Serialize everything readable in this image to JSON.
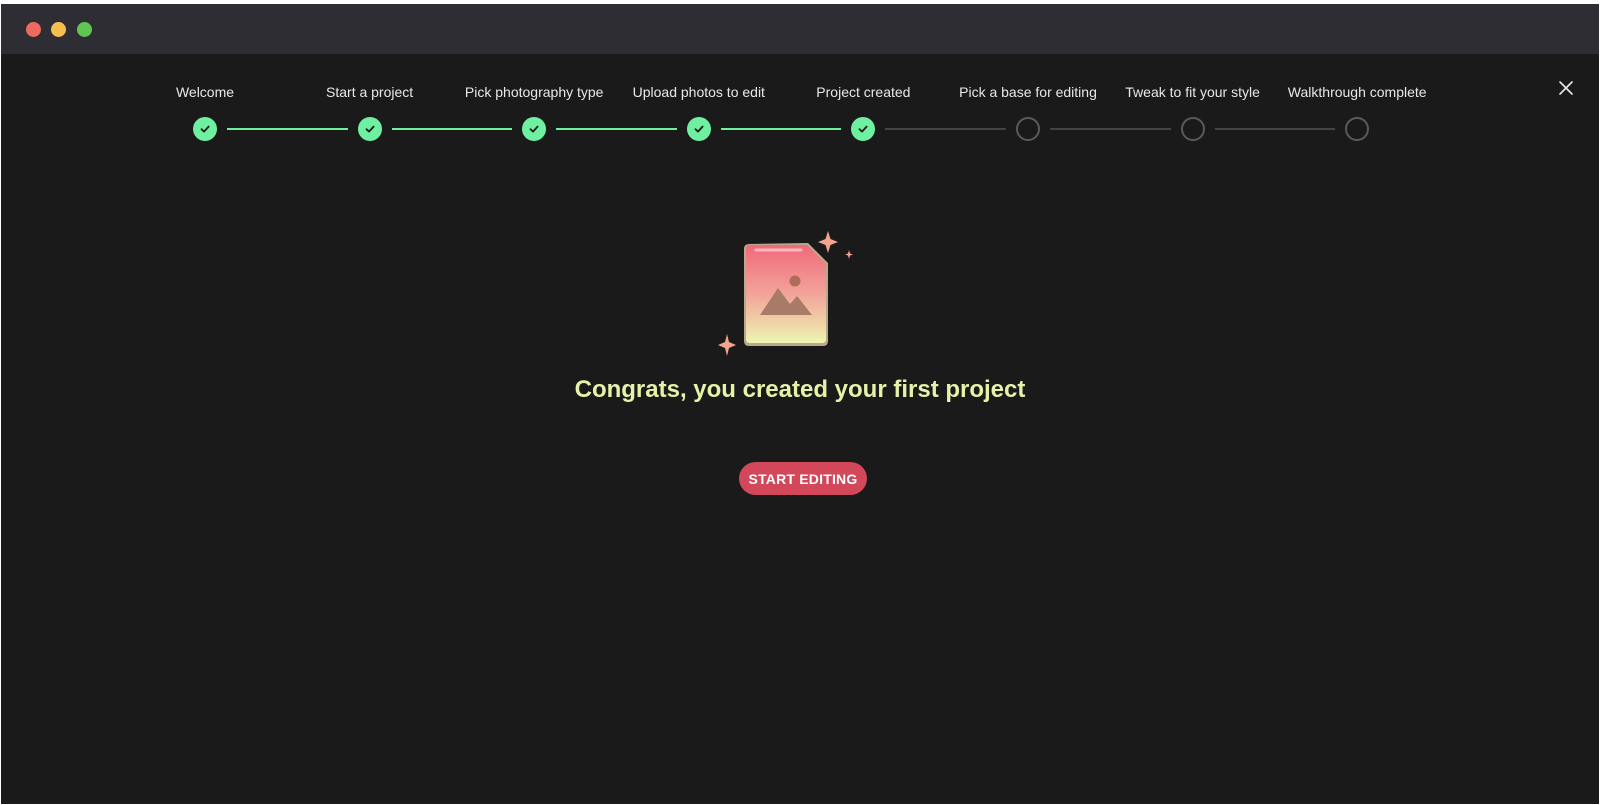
{
  "window": {
    "controls": [
      "close",
      "minimize",
      "zoom"
    ]
  },
  "stepper": {
    "steps": [
      {
        "label": "Welcome",
        "status": "done"
      },
      {
        "label": "Start a project",
        "status": "done"
      },
      {
        "label": "Pick photography type",
        "status": "done"
      },
      {
        "label": "Upload photos to edit",
        "status": "done"
      },
      {
        "label": "Project created",
        "status": "done"
      },
      {
        "label": "Pick a base for editing",
        "status": "pending"
      },
      {
        "label": "Tweak to fit your style",
        "status": "pending"
      },
      {
        "label": "Walkthrough complete",
        "status": "pending"
      }
    ],
    "completed_count": 5
  },
  "main": {
    "icon": "image-file-sparkle-icon",
    "headline": "Congrats, you created your first project",
    "cta_label": "START EDITING"
  },
  "colors": {
    "background": "#1a1a1a",
    "titlebar": "#2e2d33",
    "step_done": "#6ef0a0",
    "step_pending": "#5a5a5a",
    "headline": "#e6f2a8",
    "cta": "#d2485a"
  }
}
